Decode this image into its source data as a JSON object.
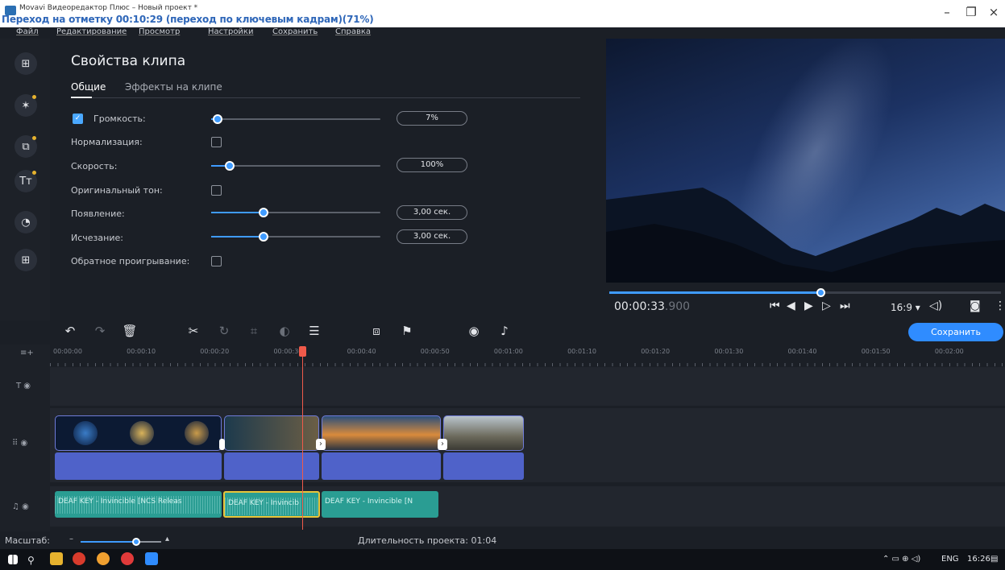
{
  "window": {
    "title": "Movavi Видеоредактор Плюс – Новый проект *",
    "hint_overlay": "Переход на отметку 00:10:29 (переход по ключевым кадрам)(71%)",
    "controls": [
      "–",
      "❐",
      "×"
    ]
  },
  "menu": [
    "Файл",
    "Редактирование",
    "Просмотр",
    "Настройки",
    "Сохранить",
    "Справка"
  ],
  "rail": [
    "import-icon",
    "magic-wand-icon",
    "transitions-icon",
    "titles-icon",
    "filters-icon",
    "more-tools-icon"
  ],
  "props": {
    "title": "Свойства клипа",
    "tabs": [
      "Общие",
      "Эффекты на клипе"
    ],
    "volume_label": "Громкость:",
    "volume_value": "7%",
    "volume_level": 0.04,
    "normalize_label": "Нормализация:",
    "speed_label": "Скорость:",
    "speed_value": "100%",
    "speed_level": 0.11,
    "pitch_label": "Оригинальный тон:",
    "fadein_label": "Появление:",
    "fadein_value": "3,00 сек.",
    "fadein_level": 0.31,
    "fadeout_label": "Исчезание:",
    "fadeout_value": "3,00 сек.",
    "fadeout_level": 0.31,
    "reverse_label": "Обратное проигрывание:"
  },
  "preview": {
    "progress": 0.54,
    "timecode_main": "00:00:33",
    "timecode_ms": ".900",
    "aspect": "16:9 ▾"
  },
  "toolbar": {
    "save_label": "Сохранить"
  },
  "ruler_ticks": [
    "00:00:00",
    "00:00:10",
    "00:00:20",
    "00:00:30",
    "00:00:40",
    "00:00:50",
    "00:01:00",
    "00:01:10",
    "00:01:20",
    "00:01:30",
    "00:01:40",
    "00:01:50",
    "00:02:00"
  ],
  "audio_clips": [
    "DEAF KEY - Invincible [NCS Releas",
    "DEAF KEY - Invincib",
    "DEAF KEY - Invincible [N"
  ],
  "status": {
    "zoom_label": "Масштаб:",
    "duration": "Длительность проекта: 01:04"
  },
  "taskbar": {
    "lang": "ENG",
    "time": "16:26"
  },
  "colors": {
    "accent": "#3f9bff",
    "video_clip": "#4f62c9",
    "audio_clip": "#2a9d93",
    "playhead": "#f05a4a"
  }
}
